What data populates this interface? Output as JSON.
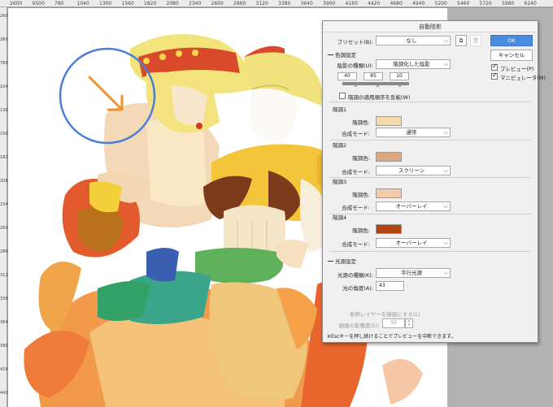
{
  "ruler": {
    "top": [
      "2600",
      "9500",
      "780",
      "1040",
      "1300",
      "1560",
      "1820",
      "2080",
      "2340",
      "2600",
      "2860",
      "3120",
      "3380",
      "3640",
      "3900",
      "4160",
      "4420",
      "4680",
      "4940",
      "5200",
      "5460",
      "5720",
      "5980",
      "6240"
    ],
    "left": [
      "260",
      "260",
      "780",
      "1040",
      "1300",
      "1560",
      "1820",
      "2080",
      "2340",
      "2600",
      "2860",
      "3120",
      "3380",
      "3640",
      "3900",
      "4160",
      "4420"
    ]
  },
  "dialog": {
    "title": "自動陰影",
    "preset_label": "プリセット(B):",
    "preset_value": "なし",
    "ok": "OK",
    "cancel": "キャンセル",
    "preview_label": "プレビュー(P)",
    "preview_checked": true,
    "manipulator_label": "マニピュレータ(M)",
    "manipulator_checked": true,
    "color_section": "色調設定",
    "shadow_type_label": "陰影の種類(U):",
    "shadow_type_value": "階調化した陰影",
    "slider_values": [
      "40",
      "85",
      "10"
    ],
    "reverse_label": "階調の適用順序を反転(W)",
    "gradients": [
      {
        "title": "階調1",
        "color_label": "階調色:",
        "color": "#f3d9ab",
        "mode_label": "合成モード:",
        "mode": "通常"
      },
      {
        "title": "階調2",
        "color_label": "階調色:",
        "color": "#dba882",
        "mode_label": "合成モード:",
        "mode": "スクリーン"
      },
      {
        "title": "階調3",
        "color_label": "階調色:",
        "color": "#f1ccaa",
        "mode_label": "合成モード:",
        "mode": "オーバーレイ"
      },
      {
        "title": "階調4",
        "color_label": "階調色:",
        "color": "#b0430e",
        "mode_label": "合成モード:",
        "mode": "オーバーレイ"
      }
    ],
    "light_section": "光源設定",
    "light_type_label": "光源の種類(K):",
    "light_type_value": "平行光源",
    "light_angle_label": "光の角度(A):",
    "light_angle_value": "43",
    "ref_layer_label": "参照レイヤーを線画にする(L)",
    "line_influence_label": "線画の影響度(E):",
    "line_influence_value": "50",
    "help_text": "※Escキーを押し続けることでプレビューを中断できます。"
  },
  "colors": {
    "accent": "#4a8ae0",
    "annotation_circle": "#4a7fd4",
    "annotation_arrow": "#f0922e"
  }
}
